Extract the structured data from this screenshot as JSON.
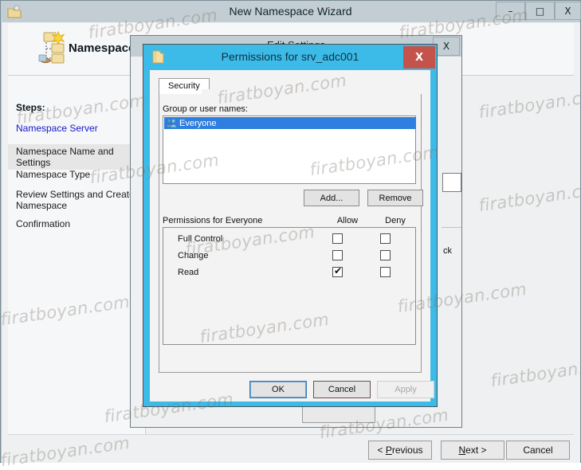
{
  "wizard": {
    "title": "New Namespace Wizard",
    "title_icon": "namespace-folder-icon",
    "header_title": "Namespace",
    "header_icon": "namespace-tree-icon",
    "minimize_label": "–",
    "maximize_label": "□",
    "close_label": "X",
    "steps_label": "Steps:",
    "steps": [
      {
        "label": "Namespace Server",
        "state": "current"
      },
      {
        "label": "Namespace Name and Settings",
        "state": "hovered"
      },
      {
        "label": "Namespace Type",
        "state": "normal"
      },
      {
        "label": "Review Settings and Create Namespace",
        "state": "normal"
      },
      {
        "label": "Confirmation",
        "state": "normal"
      }
    ],
    "footer": {
      "previous_label": "< Previous",
      "previous_accel": "P",
      "next_label": "Next >",
      "next_accel": "N",
      "cancel_label": "Cancel"
    }
  },
  "edit_settings": {
    "title": "Edit Settings",
    "close_label": "X",
    "partial_text": "ck"
  },
  "permissions": {
    "title": "Permissions for srv_adc001",
    "title_icon": "folder-icon",
    "close_label": "X",
    "tabs": [
      {
        "label": "Security",
        "selected": true
      }
    ],
    "group_label": "Group or user names:",
    "group_items": [
      {
        "label": "Everyone",
        "icon": "users-group-icon",
        "selected": true
      }
    ],
    "add_label": "Add...",
    "remove_label": "Remove",
    "perm_header_label": "Permissions for Everyone",
    "col_allow": "Allow",
    "col_deny": "Deny",
    "perm_rows": [
      {
        "label": "Full Control",
        "allow": false,
        "deny": false
      },
      {
        "label": "Change",
        "allow": false,
        "deny": false
      },
      {
        "label": "Read",
        "allow": true,
        "deny": false
      }
    ],
    "check_glyph": "✔",
    "ok_label": "OK",
    "cancel_label": "Cancel",
    "apply_label": "Apply"
  },
  "watermark": {
    "text": "firatboyan.com",
    "color": "#787068"
  },
  "colors": {
    "dialog_accent": "#3dbbe8",
    "close_red": "#c4534b",
    "selection_blue": "#2f7fe0",
    "link_blue": "#1818c8",
    "titlebar": "#c3ced4"
  }
}
